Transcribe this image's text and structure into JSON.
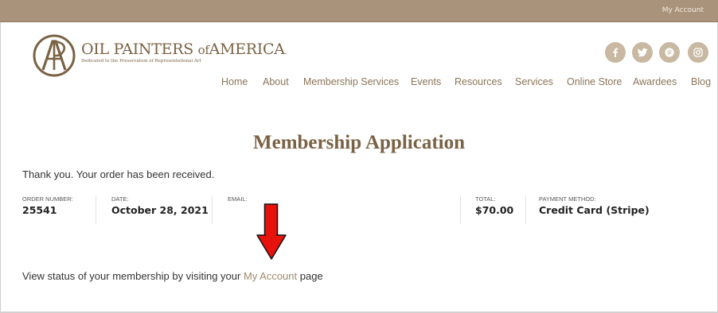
{
  "topbar": {
    "account_link": "My Account"
  },
  "header": {
    "logo_name_oil": "OIL",
    "logo_name_painters": "PAINTERS",
    "logo_name_of": "of",
    "logo_name_america": "AMERICA",
    "logo_tagline": "Dedicated to the Preservation of Representational Art",
    "social": [
      "facebook-icon",
      "twitter-icon",
      "pinterest-icon",
      "instagram-icon"
    ]
  },
  "nav": {
    "items": [
      "Home",
      "About",
      "Membership Services",
      "Events",
      "Resources",
      "Services",
      "Online Store",
      "Awardees",
      "Blog"
    ]
  },
  "main": {
    "title": "Membership Application",
    "thank_you": "Thank you. Your order has been received.",
    "order": {
      "order_number_label": "ORDER NUMBER:",
      "order_number": "25541",
      "date_label": "DATE:",
      "date": "October 28, 2021",
      "email_label": "EMAIL:",
      "email": "",
      "total_label": "TOTAL:",
      "total": "$70.00",
      "payment_label": "PAYMENT METHOD:",
      "payment": "Credit Card (Stripe)"
    },
    "status_prefix": "View status of your membership by visiting your ",
    "status_link": "My Account",
    "status_suffix": " page"
  },
  "colors": {
    "topbar": "#a9937a",
    "brand": "#7a6244",
    "nav": "#8a7457",
    "social": "#c9b9a2",
    "arrow": "#e8120c"
  }
}
